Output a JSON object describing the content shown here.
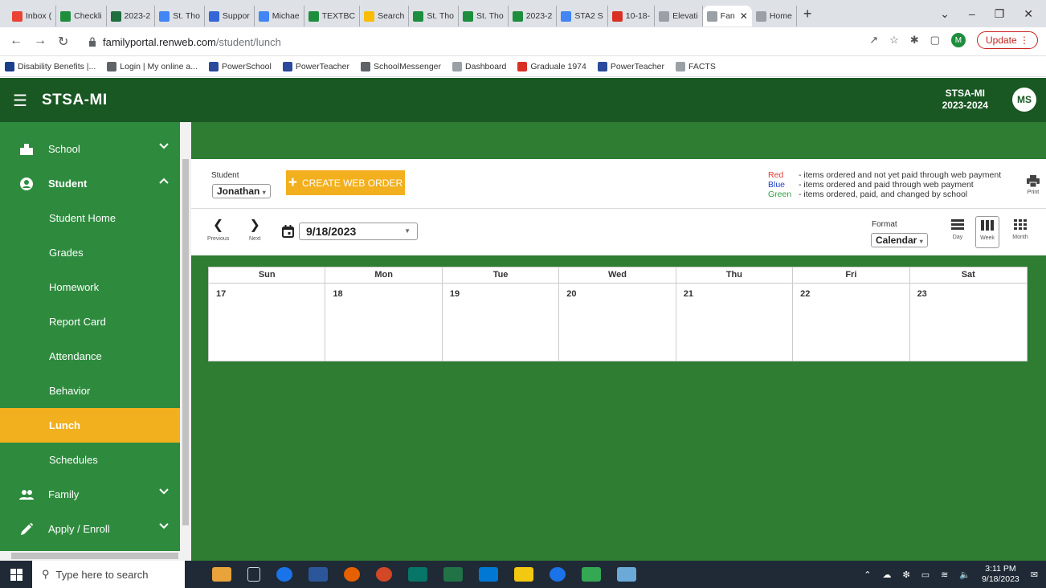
{
  "browser": {
    "tabs": [
      {
        "label": "Inbox (",
        "color": "#ea4335"
      },
      {
        "label": "Checkli",
        "color": "#1e8e3e"
      },
      {
        "label": "2023-2",
        "color": "#1e6e3e"
      },
      {
        "label": "St. Tho",
        "color": "#4285f4"
      },
      {
        "label": "Suppor",
        "color": "#3367d6"
      },
      {
        "label": "Michae",
        "color": "#4285f4"
      },
      {
        "label": "TEXTBC",
        "color": "#1e8e3e"
      },
      {
        "label": "Search",
        "color": "#fbbc04"
      },
      {
        "label": "St. Tho",
        "color": "#1e8e3e"
      },
      {
        "label": "St. Tho",
        "color": "#1e8e3e"
      },
      {
        "label": "2023-2",
        "color": "#1e8e3e"
      },
      {
        "label": "STA2 S",
        "color": "#4285f4"
      },
      {
        "label": "10-18-",
        "color": "#d93025"
      },
      {
        "label": "Elevati",
        "color": "#9aa0a6"
      },
      {
        "label": "Fan",
        "color": "#9aa0a6",
        "active": true
      },
      {
        "label": "Home",
        "color": "#9aa0a6"
      }
    ],
    "url_domain": "familyportal.renweb.com",
    "url_path": "/student/lunch",
    "update_label": "Update",
    "profile_initial": "M",
    "bookmarks": [
      {
        "label": "Disability Benefits |...",
        "color": "#1a3e8c"
      },
      {
        "label": "Login | My online a...",
        "color": "#5f6368"
      },
      {
        "label": "PowerSchool",
        "color": "#2b4a9c"
      },
      {
        "label": "PowerTeacher",
        "color": "#2b4a9c"
      },
      {
        "label": "SchoolMessenger",
        "color": "#5f6368"
      },
      {
        "label": "Dashboard",
        "color": "#9aa0a6"
      },
      {
        "label": "Graduale 1974",
        "color": "#d93025"
      },
      {
        "label": "PowerTeacher",
        "color": "#2b4a9c"
      },
      {
        "label": "FACTS",
        "color": "#9aa0a6"
      }
    ]
  },
  "header": {
    "app_title": "STSA-MI",
    "school": "STSA-MI",
    "year": "2023-2024",
    "user_initials": "MS"
  },
  "sidebar": {
    "items": [
      {
        "label": "School",
        "icon": "building-icon",
        "chevron": "down"
      },
      {
        "label": "Student",
        "icon": "user-circle-icon",
        "chevron": "up",
        "bold": true
      },
      {
        "label": "Student Home",
        "sub": true
      },
      {
        "label": "Grades",
        "sub": true
      },
      {
        "label": "Homework",
        "sub": true
      },
      {
        "label": "Report Card",
        "sub": true
      },
      {
        "label": "Attendance",
        "sub": true
      },
      {
        "label": "Behavior",
        "sub": true
      },
      {
        "label": "Lunch",
        "sub": true,
        "active": true
      },
      {
        "label": "Schedules",
        "sub": true
      },
      {
        "label": "Family",
        "icon": "people-icon",
        "chevron": "down"
      },
      {
        "label": "Apply / Enroll",
        "icon": "pencil-icon",
        "chevron": "down"
      }
    ]
  },
  "lunch": {
    "student_label": "Student",
    "student_value": "Jonathan",
    "create_order_label": "CREATE WEB ORDER",
    "legend": [
      {
        "color_name": "Red",
        "text": "- items ordered and not yet paid through web payment",
        "color": "#e53935"
      },
      {
        "color_name": "Blue",
        "text": "- items ordered and paid through web payment",
        "color": "#1e40c8"
      },
      {
        "color_name": "Green",
        "text": "- items ordered, paid, and changed by school",
        "color": "#2e9e3e"
      }
    ],
    "print_label": "Print",
    "previous_label": "Previous",
    "next_label": "Next",
    "date_value": "9/18/2023",
    "format_label": "Format",
    "format_value": "Calendar",
    "views": [
      {
        "label": "Day",
        "icon": "day-view-icon"
      },
      {
        "label": "Week",
        "icon": "week-view-icon",
        "active": true
      },
      {
        "label": "Month",
        "icon": "month-view-icon"
      }
    ],
    "calendar": {
      "days": [
        "Sun",
        "Mon",
        "Tue",
        "Wed",
        "Thu",
        "Fri",
        "Sat"
      ],
      "dates": [
        "17",
        "18",
        "19",
        "20",
        "21",
        "22",
        "23"
      ]
    }
  },
  "taskbar": {
    "search_placeholder": "Type here to search",
    "time": "3:11 PM",
    "date": "9/18/2023"
  }
}
